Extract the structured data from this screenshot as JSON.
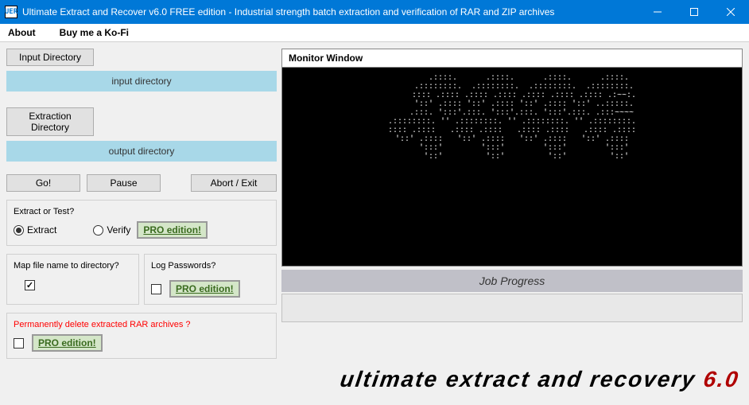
{
  "window": {
    "title": "Ultimate Extract and Recover v6.0 FREE edition - Industrial strength batch extraction and verification of RAR and ZIP archives",
    "icon_text": "UER"
  },
  "menu": {
    "about": "About",
    "kofi": "Buy me a Ko-Fi"
  },
  "left": {
    "input_dir_btn": "Input Directory",
    "input_dir_value": "input directory",
    "extract_dir_btn": "Extraction Directory",
    "extract_dir_value": "output directory",
    "go": "Go!",
    "pause": "Pause",
    "abort": "Abort / Exit",
    "extract_test_label": "Extract or Test?",
    "extract": "Extract",
    "verify": "Verify",
    "pro": "PRO edition!",
    "map_label": "Map file name to directory?",
    "log_label": "Log Passwords?",
    "delete_label": "Permanently delete extracted RAR archives  ?"
  },
  "monitor": {
    "header": "Monitor Window",
    "ascii": "       .::::.      .::::.      .::::.      .::::.\n     .::::::::.  .::::::::.  .::::::::.  .::::::::.\n     :::: .:::: .:::: .:::: .:::: .:::: .:::: .:~~:.\n     '::' .:::: '::' .:::: '::' .:::: '::' ..:::::.\n    .:::. ':::'.:::. ':::'.:::. ':::'.:::. .:::~~~~\n.::::::::. '' .::::::::. '' .::::::::. '' .::::::::.\n:::: .::::   .:::: .::::   .:::: .::::   .:::: .::::\n'::' .::::   '::' .::::   '::' .::::   '::' .::::\n     ':::'        ':::'        ':::'        ':::'\n      '::'         '::'         '::'         '::'"
  },
  "progress": {
    "label": "Job Progress"
  },
  "footer": {
    "text": "ultimate extract and recovery ",
    "version": "6.0"
  }
}
